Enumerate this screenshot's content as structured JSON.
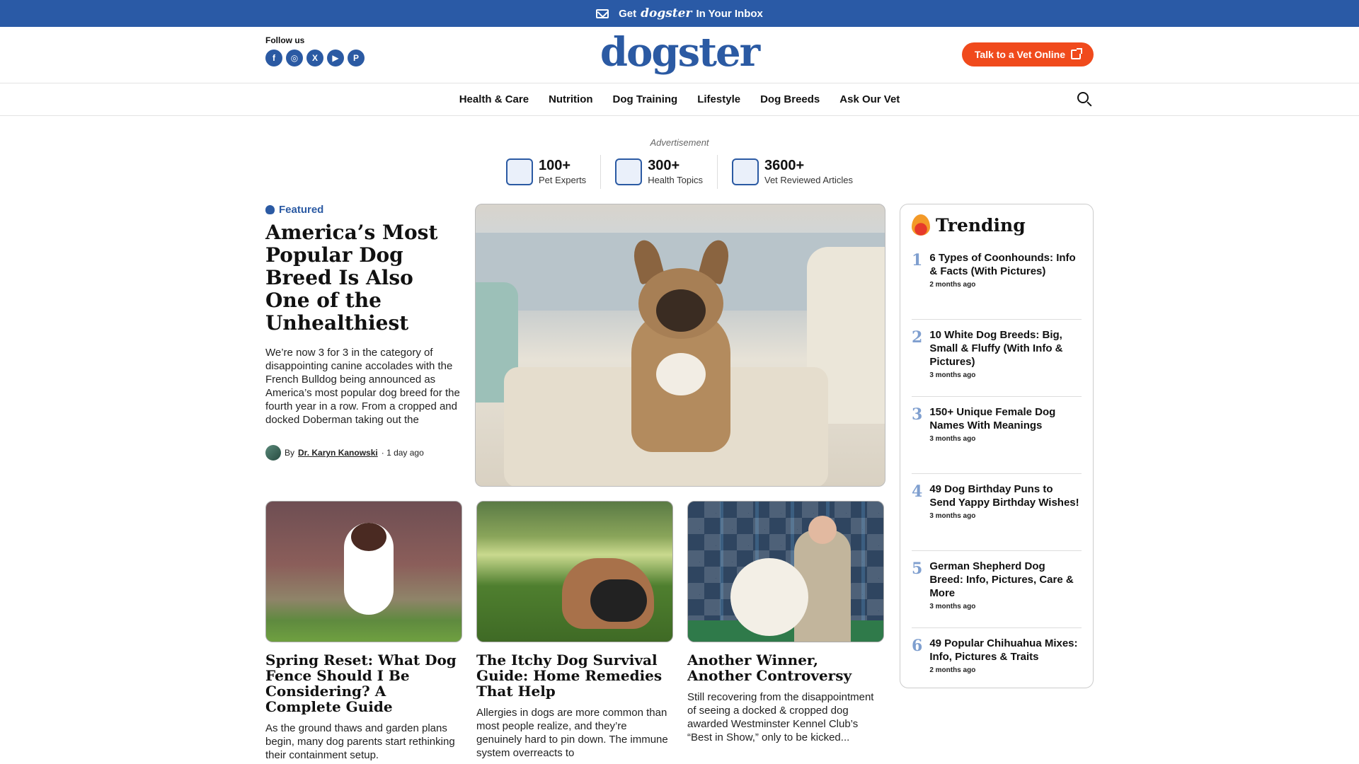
{
  "banner": {
    "prefix": "Get",
    "brand": "dogster",
    "suffix": "In Your Inbox"
  },
  "header": {
    "follow_label": "Follow us",
    "socials": [
      "f",
      "◎",
      "X",
      "▶",
      "P"
    ],
    "logo": "dogster",
    "vet_button": "Talk to a Vet Online"
  },
  "nav": {
    "items": [
      "Health & Care",
      "Nutrition",
      "Dog Training",
      "Lifestyle",
      "Dog Breeds",
      "Ask Our Vet"
    ]
  },
  "ad_label": "Advertisement",
  "stats": [
    {
      "num": "100+",
      "label": "Pet Experts"
    },
    {
      "num": "300+",
      "label": "Health Topics"
    },
    {
      "num": "3600+",
      "label": "Vet Reviewed Articles"
    }
  ],
  "featured": {
    "tag": "Featured",
    "title": "America’s Most Popular Dog Breed Is Also One of the Unhealthiest",
    "excerpt": "We’re now 3 for 3 in the category of disappointing canine accolades with the French Bulldog being announced as America’s most popular dog breed for the fourth year in a row. From a cropped and docked Doberman taking out the",
    "by": "By",
    "author": "Dr. Karyn Kanowski",
    "time": "· 1 day ago"
  },
  "trending": {
    "title": "Trending",
    "items": [
      {
        "num": "1",
        "title": "6 Types of Coonhounds: Info & Facts (With Pictures)",
        "time": "2 months ago"
      },
      {
        "num": "2",
        "title": "10 White Dog Breeds: Big, Small & Fluffy (With Info & Pictures)",
        "time": "3 months ago"
      },
      {
        "num": "3",
        "title": "150+ Unique Female Dog Names With Meanings",
        "time": "3 months ago"
      },
      {
        "num": "4",
        "title": "49 Dog Birthday Puns to Send Yappy Birthday Wishes!",
        "time": "3 months ago"
      },
      {
        "num": "5",
        "title": "German Shepherd Dog Breed: Info, Pictures, Care & More",
        "time": "3 months ago"
      },
      {
        "num": "6",
        "title": "49 Popular Chihuahua Mixes: Info, Pictures & Traits",
        "time": "2 months ago"
      }
    ]
  },
  "cards": [
    {
      "title": "Spring Reset: What Dog Fence Should I Be Considering? A Complete Guide",
      "excerpt": "As the ground thaws and garden plans begin, many dog parents start rethinking their containment setup."
    },
    {
      "title": "The Itchy Dog Survival Guide: Home Remedies That Help",
      "excerpt": "Allergies in dogs are more common than most people realize, and they’re genuinely hard to pin down. The immune system overreacts to"
    },
    {
      "title": "Another Winner, Another Controversy",
      "excerpt": "Still recovering from the disappointment of seeing a docked & cropped dog awarded Westminster Kennel Club’s “Best in Show,” only to be kicked..."
    }
  ]
}
